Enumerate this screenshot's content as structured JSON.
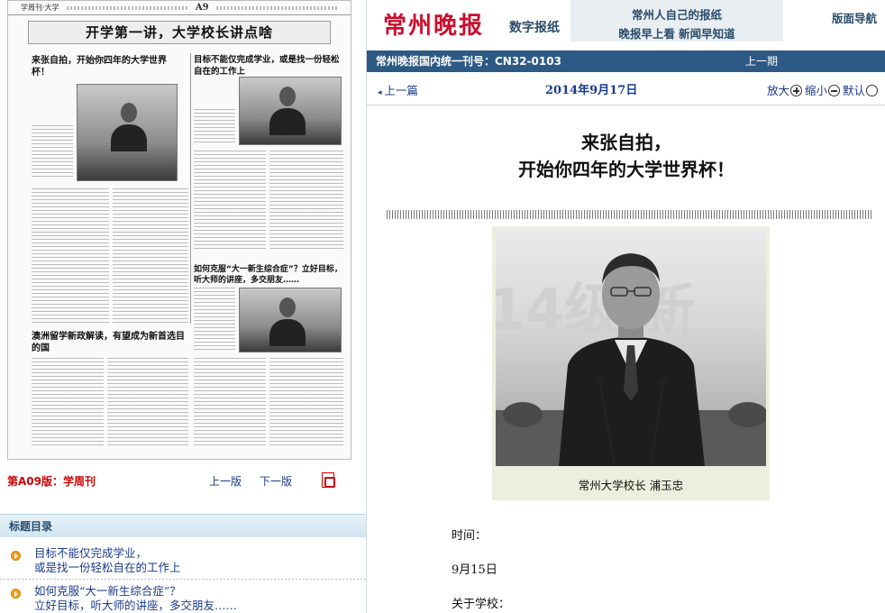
{
  "left": {
    "page_thumbnail": {
      "section": "学周刊·大学",
      "page_no": "A9",
      "banner": "开学第一讲，大学校长讲点啥",
      "article1_title": "来张自拍，开始你四年的大学世界杯！",
      "article2_title": "目标不能仅完成学业，或是找一份轻松自在的工作上",
      "article3_title": "如何克服“大一新生综合症”？立好目标，听大师的讲座，多交朋友……",
      "article4_title": "澳洲留学新政解读，有望成为新首选目的国"
    },
    "page_nav": {
      "edition": "第A09版：学周刊",
      "prev": "上一版",
      "next": "下一版",
      "pdf_icon": "pdf-icon"
    },
    "toc": {
      "heading": "标题目录",
      "items": [
        {
          "line1": "目标不能仅完成学业，",
          "line2": "或是找一份轻松自在的工作上"
        },
        {
          "line1": "如何克服“大一新生综合症”？",
          "line2": "立好目标，听大师的讲座，多交朋友……"
        }
      ]
    }
  },
  "right": {
    "header": {
      "logo": "常州晚报",
      "logo_sub": "数字报纸",
      "slogan1": "常州人自己的报纸",
      "slogan2": "晚报早上看 新闻早知道",
      "nav": "版面导航"
    },
    "bluebar": {
      "cn": "常州晚报国内统一刊号：CN32-0103",
      "prev_issue": "上一期"
    },
    "subbar": {
      "prev_article": "上一篇",
      "date": "2014年9月17日",
      "zoom_in": "放大",
      "zoom_out": "缩小",
      "zoom_default": "默认"
    },
    "article": {
      "headline1": "来张自拍，",
      "headline2": "开始你四年的大学世界杯！",
      "photo_caption": "常州大学校长 浦玉忠",
      "photo_backdrop_text": "14级 新",
      "time_label": "时间：",
      "time_value": "9月15日",
      "about_label": "关于学校："
    }
  }
}
